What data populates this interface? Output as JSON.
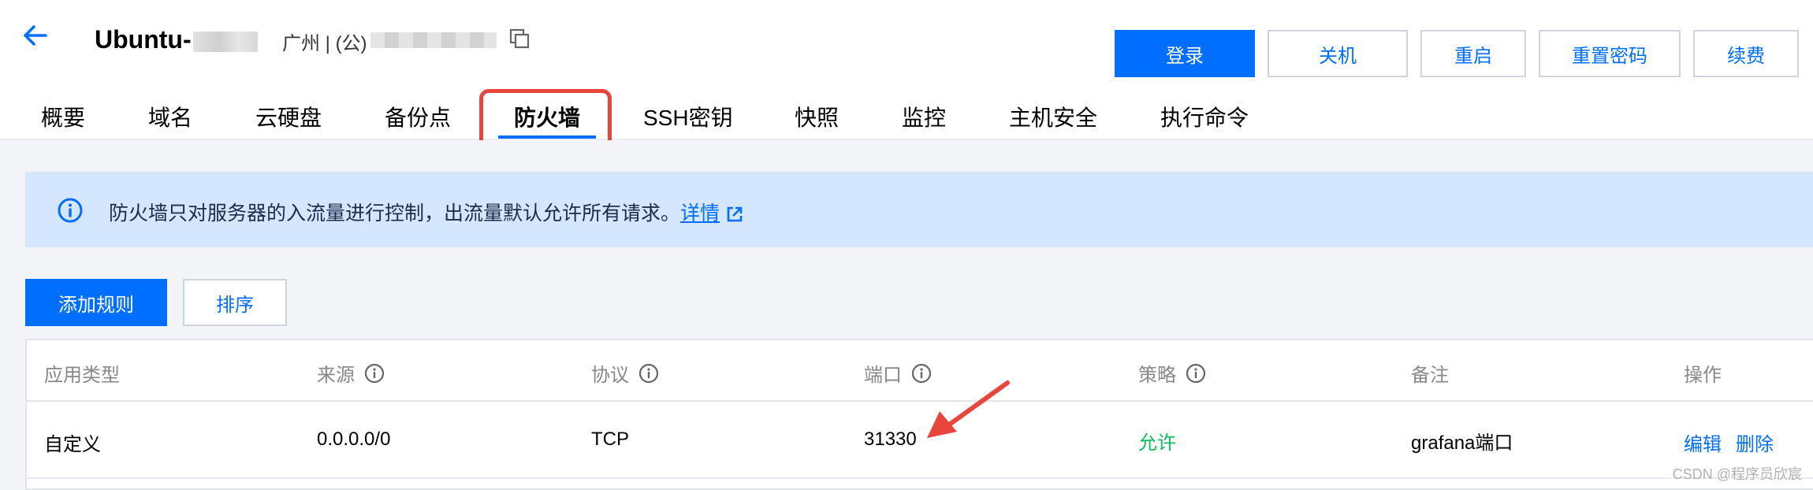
{
  "header": {
    "instance_name": "Ubuntu-",
    "region": "广州 | (公)",
    "actions": [
      {
        "label": "登录",
        "primary": true
      },
      {
        "label": "关机",
        "primary": false
      },
      {
        "label": "重启",
        "primary": false
      },
      {
        "label": "重置密码",
        "primary": false
      },
      {
        "label": "续费",
        "primary": false
      }
    ]
  },
  "tabs": [
    {
      "label": "概要"
    },
    {
      "label": "域名"
    },
    {
      "label": "云硬盘"
    },
    {
      "label": "备份点"
    },
    {
      "label": "防火墙",
      "active": true
    },
    {
      "label": "SSH密钥"
    },
    {
      "label": "快照"
    },
    {
      "label": "监控"
    },
    {
      "label": "主机安全"
    },
    {
      "label": "执行命令"
    }
  ],
  "notice": {
    "text": "防火墙只对服务器的入流量进行控制，出流量默认允许所有请求。",
    "link": "详情"
  },
  "toolbar": {
    "add_rule": "添加规则",
    "sort": "排序"
  },
  "table": {
    "columns": [
      "应用类型",
      "来源",
      "协议",
      "端口",
      "策略",
      "备注",
      "操作"
    ],
    "rows": [
      {
        "app_type": "自定义",
        "source": "0.0.0.0/0",
        "protocol": "TCP",
        "port": "31330",
        "policy": "允许",
        "remark": "grafana端口",
        "action_edit": "编辑",
        "action_delete": "删除"
      }
    ]
  },
  "watermark": "CSDN @程序员欣宸",
  "colors": {
    "primary": "#006eff",
    "allow": "#0abf5b",
    "highlight": "#e8453c",
    "notice_bg": "#d5e7ff"
  },
  "icons": [
    "back-arrow-icon",
    "copy-icon",
    "info-icon",
    "external-link-icon",
    "pointer-arrow-icon"
  ]
}
